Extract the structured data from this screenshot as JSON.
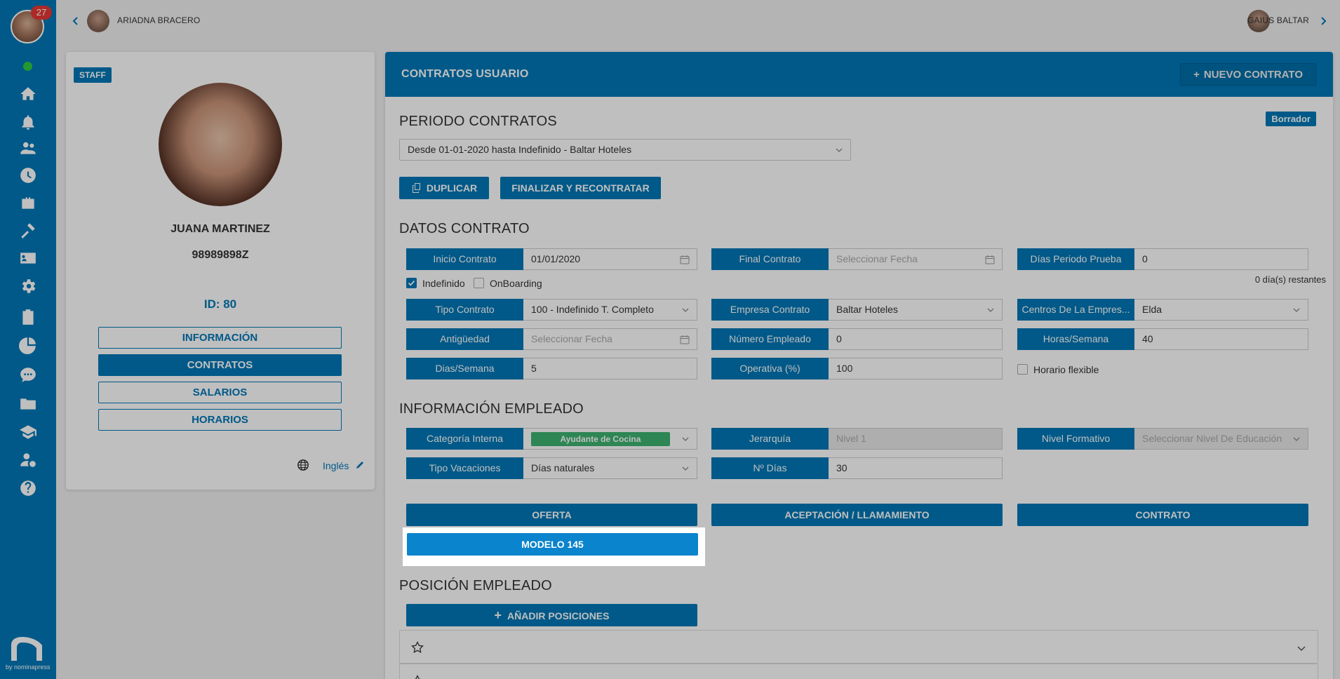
{
  "sidebar": {
    "notification_count": "27",
    "icons": [
      "home-icon",
      "bell-icon",
      "users-icon",
      "clock-icon",
      "briefcase-icon",
      "tools-icon",
      "id-card-icon",
      "gear-icon",
      "clipboard-icon",
      "pie-chart-icon",
      "chat-icon",
      "folder-icon",
      "graduation-icon",
      "user-money-icon",
      "help-icon"
    ],
    "logo_by": "by nominapress"
  },
  "topbar": {
    "left_user": "ARIADNA BRACERO",
    "right_user": "GAIUS BALTAR"
  },
  "profile": {
    "badge": "STAFF",
    "name": "JUANA MARTINEZ",
    "dni": "98989898Z",
    "id_label": "ID: 80",
    "nav": [
      {
        "label": "INFORMACIÓN",
        "active": false
      },
      {
        "label": "CONTRATOS",
        "active": true
      },
      {
        "label": "SALARIOS",
        "active": false
      },
      {
        "label": "HORARIOS",
        "active": false
      }
    ],
    "language": "Inglés"
  },
  "main": {
    "title": "CONTRATOS USUARIO",
    "new_contract_label": "NUEVO CONTRATO",
    "periodo_title": "PERIODO CONTRATOS",
    "status_badge": "Borrador",
    "periodo_value": "Desde 01-01-2020 hasta Indefinido - Baltar Hoteles",
    "duplicate_label": "DUPLICAR",
    "finalize_label": "FINALIZAR Y RECONTRATAR",
    "datos_title": "DATOS CONTRATO",
    "fields": {
      "inicio": {
        "label": "Inicio Contrato",
        "value": "01/01/2020"
      },
      "final": {
        "label": "Final Contrato",
        "placeholder": "Seleccionar Fecha"
      },
      "prueba": {
        "label": "Días Periodo Prueba",
        "value": "0"
      },
      "restantes": "0 día(s) restantes",
      "indefinido": "Indefinido",
      "onboarding": "OnBoarding",
      "tipo": {
        "label": "Tipo Contrato",
        "value": "100 - Indefinido T. Completo"
      },
      "empresa": {
        "label": "Empresa Contrato",
        "value": "Baltar Hoteles"
      },
      "centros": {
        "label": "Centros De La Empres...",
        "value": "Elda"
      },
      "antiguedad": {
        "label": "Antigüedad",
        "placeholder": "Seleccionar Fecha"
      },
      "numero": {
        "label": "Número Empleado",
        "value": "0"
      },
      "horas": {
        "label": "Horas/Semana",
        "value": "40"
      },
      "dias": {
        "label": "Dias/Semana",
        "value": "5"
      },
      "operativa": {
        "label": "Operativa (%)",
        "value": "100"
      },
      "flexible": "Horario flexible"
    },
    "info_title": "INFORMACIÓN EMPLEADO",
    "info": {
      "categoria": {
        "label": "Categoría Interna",
        "value": "Ayudante de Cocina"
      },
      "jerarquia": {
        "label": "Jerarquía",
        "value": "Nivel 1"
      },
      "nivel": {
        "label": "Nivel Formativo",
        "placeholder": "Seleccionar Nivel De Educación"
      },
      "vacaciones": {
        "label": "Tipo Vacaciones",
        "value": "Días naturales"
      },
      "num_dias": {
        "label": "Nº Días",
        "value": "30"
      }
    },
    "docs": {
      "oferta": "OFERTA",
      "aceptacion": "ACEPTACIÓN / LLAMAMIENTO",
      "contrato": "CONTRATO",
      "modelo": "MODELO 145"
    },
    "posicion_title": "POSICIÓN EMPLEADO",
    "add_position_label": "AÑADIR POSICIONES"
  },
  "colors": {
    "primary": "#0077b6",
    "tag_green": "#3cb371",
    "badge_red": "#e53935"
  }
}
